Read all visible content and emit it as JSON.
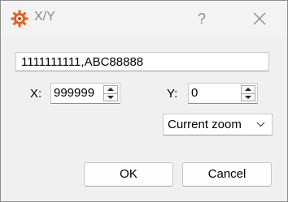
{
  "window": {
    "title": "X/Y"
  },
  "titlebar": {
    "help_label": "?",
    "close_icon": "close-icon",
    "app_icon": "xnview-gear-icon"
  },
  "main": {
    "text_value": "1111111111,ABC88888",
    "x_label": "X:",
    "x_value": "999999",
    "y_label": "Y:",
    "y_value": "0",
    "zoom_selected": "Current zoom"
  },
  "buttons": {
    "ok_label": "OK",
    "cancel_label": "Cancel"
  },
  "colors": {
    "icon_orange": "#e8601c",
    "window_bg": "#f0f0f0",
    "title_gray": "#8a8a8a"
  }
}
